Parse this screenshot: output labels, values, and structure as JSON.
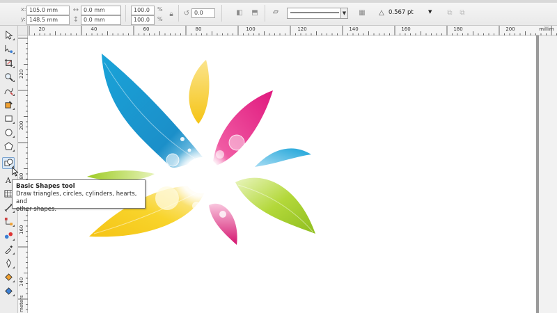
{
  "propbar": {
    "x_label": "x:",
    "x_value": "105.0 mm",
    "y_label": "y:",
    "y_value": "148.5 mm",
    "w_value": "0.0 mm",
    "h_value": "0.0 mm",
    "scale_x": "100.0",
    "scale_y": "100.0",
    "percent": "%",
    "rotation": "0.0",
    "outline_width": "0.567 pt"
  },
  "ruler": {
    "h_ticks": [
      "20",
      "40",
      "60",
      "80",
      "100",
      "120",
      "140",
      "160",
      "180",
      "200",
      "millim"
    ],
    "v_ticks": [
      "220",
      "200",
      "180",
      "160",
      "140",
      "meters"
    ]
  },
  "tooltip": {
    "title": "Basic Shapes tool",
    "description_line1": "Draw triangles, circles, cylinders, hearts, and",
    "description_line2": "other shapes."
  },
  "tools": [
    "pick-tool-icon",
    "shape-tool-icon",
    "crop-tool-icon",
    "zoom-tool-icon",
    "freehand-tool-icon",
    "smart-fill-icon",
    "rectangle-tool-icon",
    "ellipse-tool-icon",
    "polygon-tool-icon",
    "basic-shapes-tool-icon",
    "text-tool-icon",
    "table-tool-icon",
    "dimension-tool-icon",
    "connector-tool-icon",
    "blend-tool-icon",
    "eyedropper-tool-icon",
    "outline-tool-icon",
    "fill-tool-icon",
    "interactive-fill-icon"
  ],
  "colors": {
    "cyan": "#1aa3d8",
    "magenta": "#e0197e",
    "yellow": "#f7cc1c",
    "green": "#a6cf2a"
  }
}
